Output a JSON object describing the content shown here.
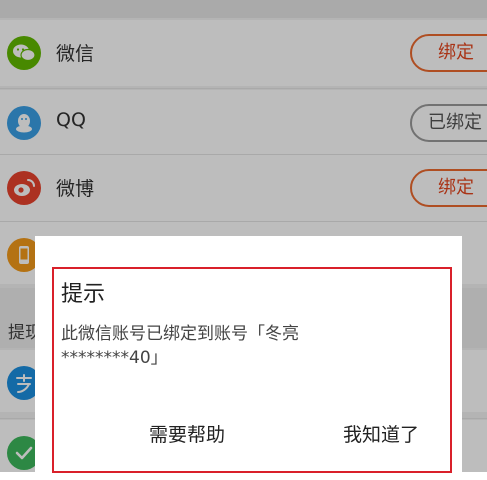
{
  "sections": {
    "top_label": "",
    "withdraw_label": "提现"
  },
  "accounts": [
    {
      "name": "微信",
      "icon": "wechat-icon",
      "status": "绑定",
      "bound": false
    },
    {
      "name": "QQ",
      "icon": "qq-icon",
      "status": "已绑定",
      "bound": true
    },
    {
      "name": "微博",
      "icon": "weibo-icon",
      "status": "绑定",
      "bound": false
    },
    {
      "name": "",
      "icon": "phone-icon",
      "status": "",
      "bound": false
    }
  ],
  "withdraw_accounts": [
    {
      "icon": "alipay-icon"
    },
    {
      "icon": "check-icon"
    }
  ],
  "dialog": {
    "title": "提示",
    "message_line1": "此微信账号已绑定到账号「冬亮",
    "message_line2": "********40」",
    "help_button": "需要帮助",
    "ok_button": "我知道了"
  },
  "colors": {
    "accent": "#e5471f",
    "highlight_border": "#d9202a",
    "wechat": "#62b900",
    "qq": "#3aa0e6",
    "weibo": "#e8432d"
  }
}
